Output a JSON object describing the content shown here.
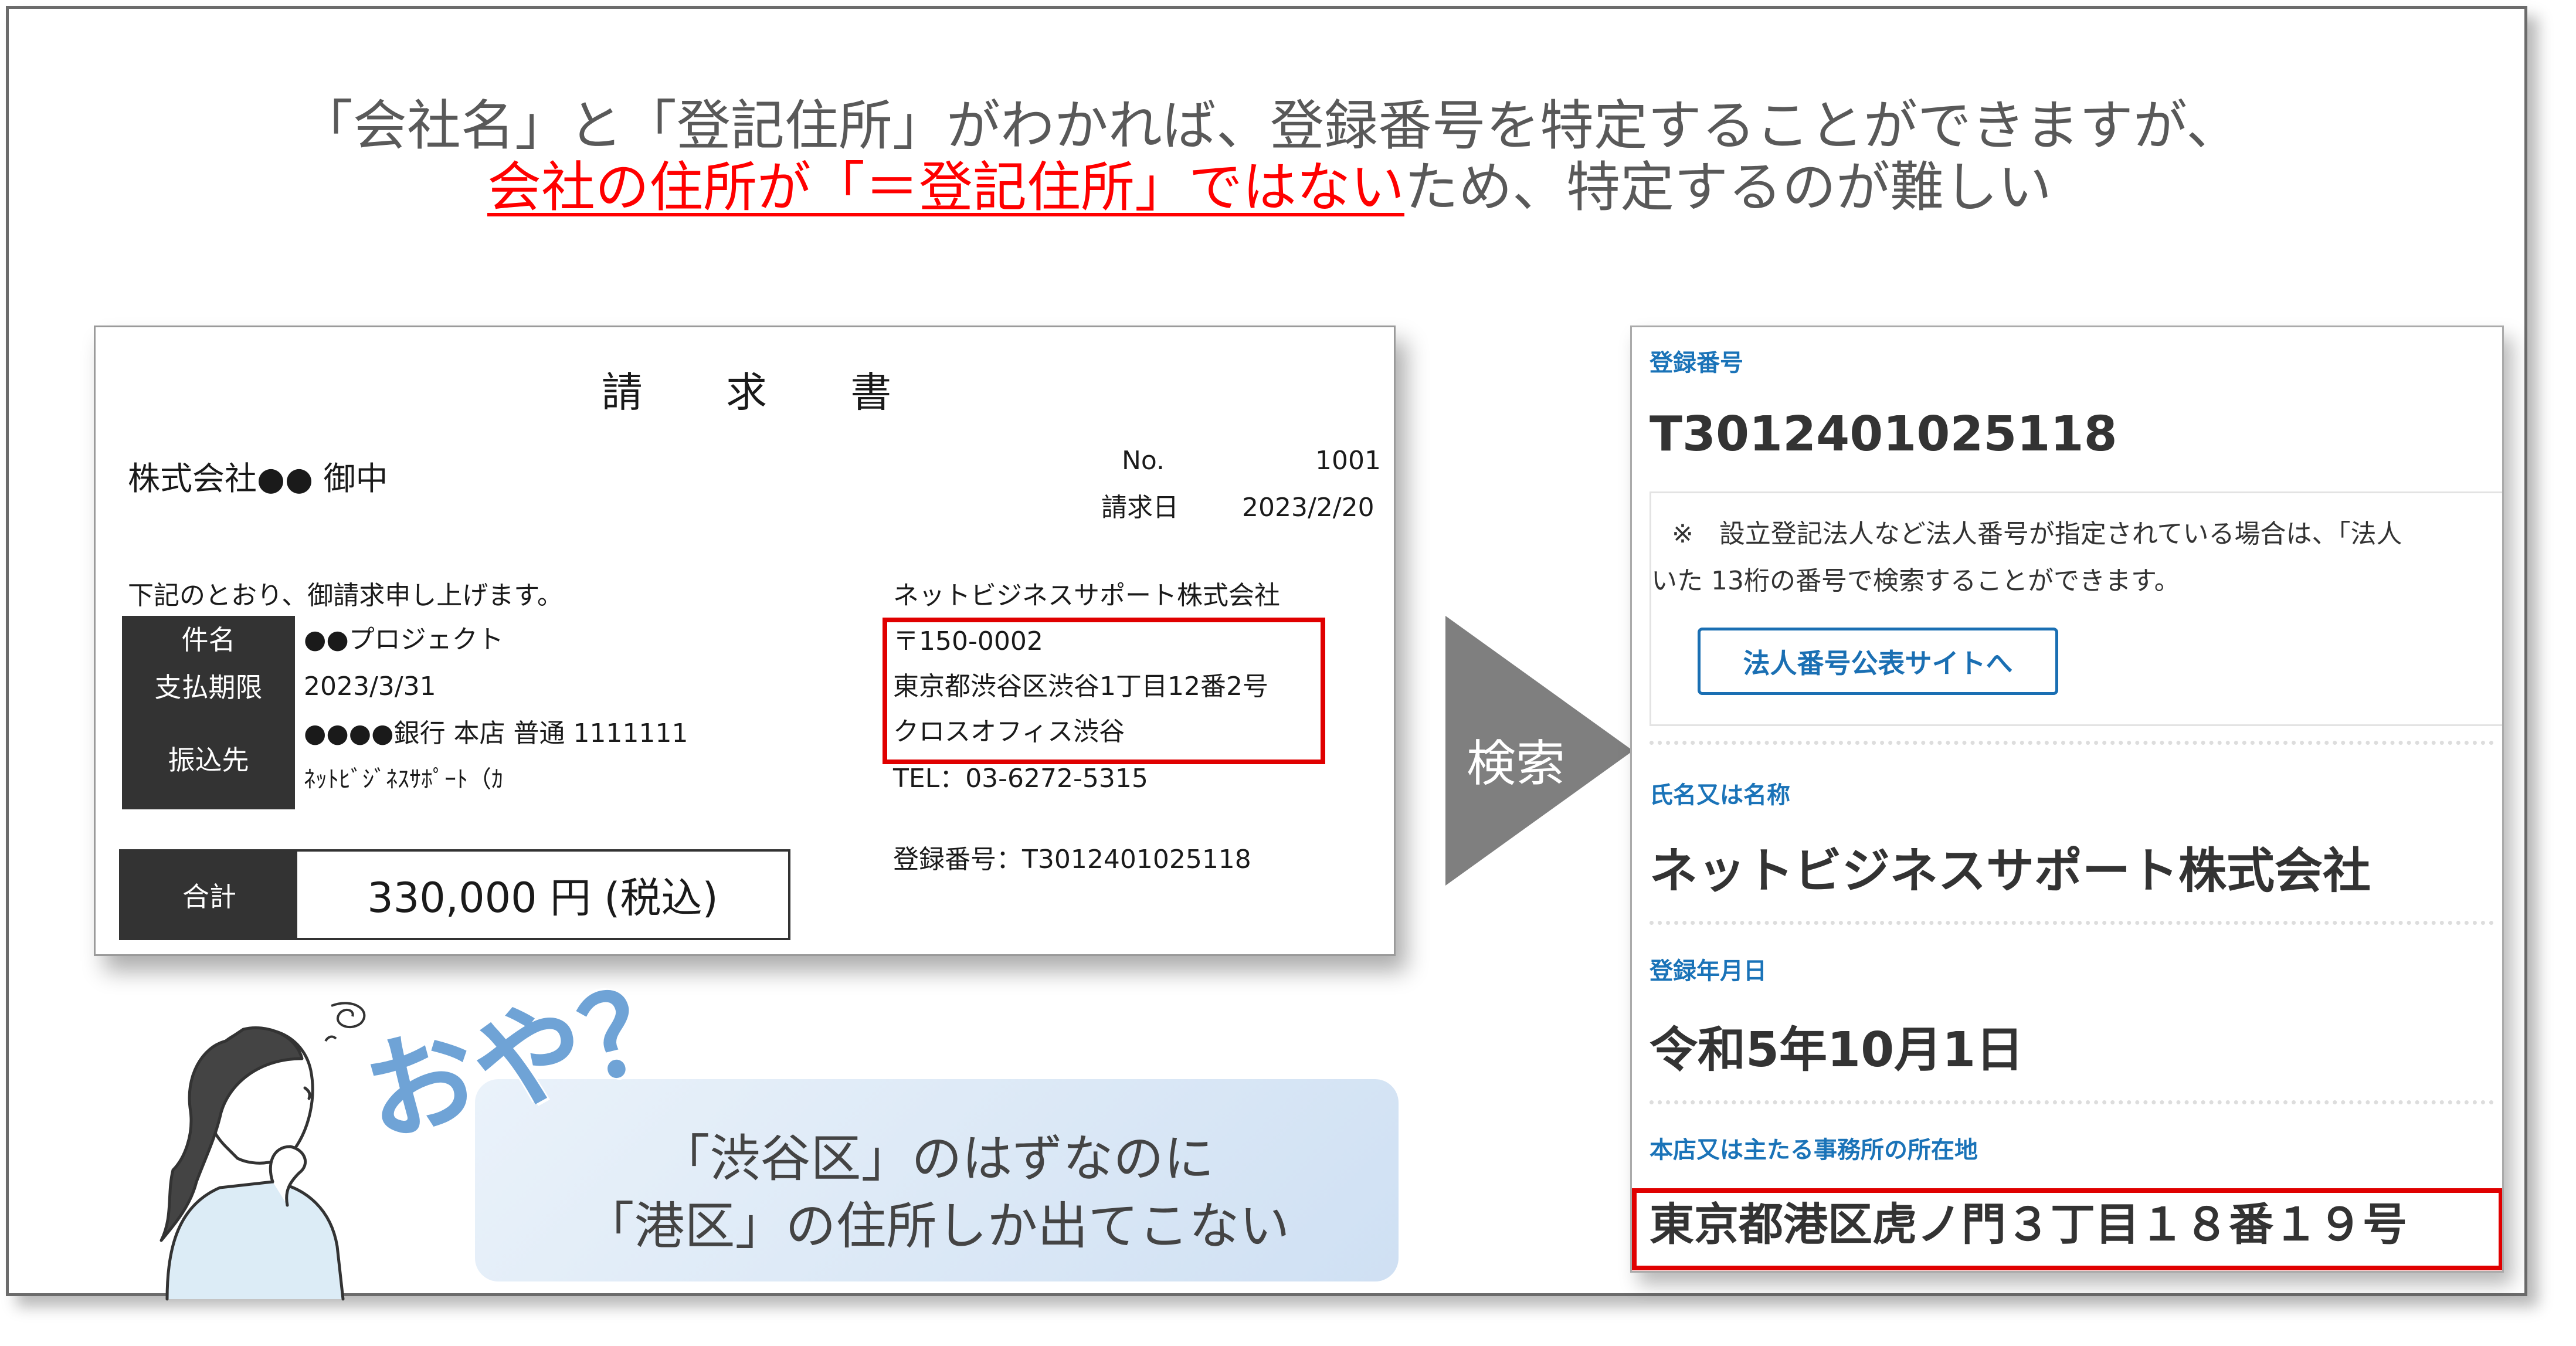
{
  "headline": {
    "line1": "「会社名」と「登記住所」がわかれば、登録番号を特定することができますが、",
    "line2_highlight": "会社の住所が「＝登記住所」ではない",
    "line2_rest": "ため、特定するのが難しい"
  },
  "invoice": {
    "title": "請 求 書",
    "recipient": "株式会社●● 御中",
    "no_label": "No.",
    "no_value": "1001",
    "date_label": "請求日",
    "date_value": "2023/2/20",
    "intro": "下記のとおり、御請求申し上げます。",
    "rows": [
      {
        "label": "件名",
        "value": "●●プロジェクト"
      },
      {
        "label": "支払期限",
        "value": "2023/3/31"
      },
      {
        "label": "振込先",
        "value": "●●●●銀行 本店 普通 1111111",
        "value2": "ﾈｯﾄﾋﾞｼﾞﾈｽｻﾎﾟｰﾄ（ｶ"
      }
    ],
    "total_label": "合計",
    "total_value": "330,000 円 (税込)",
    "issuer_name": "ネットビジネスサポート株式会社",
    "postal": "〒150-0002",
    "address1": "東京都渋谷区渋谷1丁目12番2号",
    "address2": "クロスオフィス渋谷",
    "tel": "TEL：03-6272-5315",
    "reg_number": "登録番号：T3012401025118"
  },
  "arrow_label": "検索",
  "registry": {
    "reg_label": "登録番号",
    "reg_value": "T3012401025118",
    "notice_line1": "※　設立登記法人など法人番号が指定されている場合は、「法人",
    "notice_line2": "いた 13桁の番号で検索することができます。",
    "button_label": "法人番号公表サイトへ",
    "name_label": "氏名又は名称",
    "name_value": "ネットビジネスサポート株式会社",
    "date_label": "登録年月日",
    "date_value": "令和5年10月1日",
    "address_label": "本店又は主たる事務所の所在地",
    "address_value": "東京都港区虎ノ門３丁目１８番１９号"
  },
  "bubble": {
    "exclaim": "おや？",
    "line1": "「渋谷区」のはずなのに",
    "line2": "「港区」の住所しか出てこない"
  },
  "colors": {
    "accent_red": "#e00000",
    "registry_blue": "#1a73b8",
    "dark_label": "#333333",
    "headline_gray": "#595959"
  }
}
